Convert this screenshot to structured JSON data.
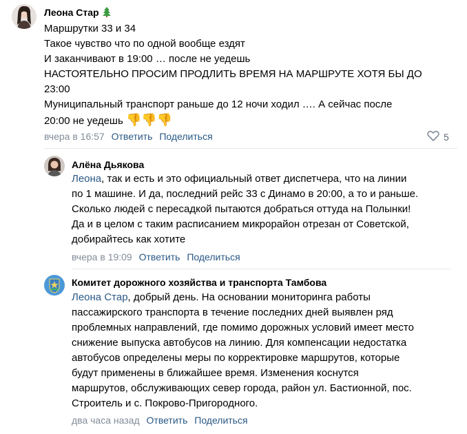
{
  "comments": [
    {
      "author": "Леона Стар",
      "author_badge_icon": "christmas-tree-icon",
      "lines": [
        "Маршрутки 33 и 34",
        "Такое чувство что по одной вообще ездят",
        "И заканчивают в 19:00 … после не уедешь",
        "НАСТОЯТЕЛЬНО ПРОСИМ ПРОДЛИТЬ ВРЕМЯ НА МАРШРУТЕ ХОТЯ БЫ ДО",
        "23:00",
        "Муниципальный транспорт раньше до 12 ночи ходил …. А сейчас после",
        "20:00 не уедешь"
      ],
      "emoji": "👎👎👎",
      "time": "вчера в 16:57",
      "reply_label": "Ответить",
      "share_label": "Поделиться",
      "likes": "5"
    },
    {
      "author": "Алёна Дьякова",
      "mention": "Леона",
      "first_line_rest": ", так и есть и это официальный ответ диспетчера, что на линии",
      "lines": [
        "по 1 машине. И да, последний рейс 33 с Динамо в 20:00, а то и раньше.",
        "Сколько людей с пересадкой пытаются добраться оттуда на Полынки!",
        "Да и в целом с таким расписанием микрорайон отрезан от Советской,",
        "добирайтесь как хотите"
      ],
      "time": "вчера в 19:09",
      "reply_label": "Ответить",
      "share_label": "Поделиться"
    },
    {
      "author": "Комитет дорожного хозяйства и транспорта Тамбова",
      "mention": "Леона Стар",
      "first_line_rest": ", добрый день. На основании мониторинга работы",
      "lines": [
        "пассажирского транспорта в течение последних дней выявлен ряд",
        "проблемных направлений, где помимо дорожных условий имеет место",
        "снижение выпуска автобусов на линию. Для компенсации недостатка",
        "автобусов определены меры по корректировке маршрутов, которые",
        "будут применены в ближайшее время. Изменения коснутся",
        "маршрутов, обслуживающих север города, район ул. Бастионной, пос.",
        "Строитель и с. Покрово-Пригородного."
      ],
      "time": "два часа назад",
      "reply_label": "Ответить",
      "share_label": "Поделиться"
    }
  ]
}
